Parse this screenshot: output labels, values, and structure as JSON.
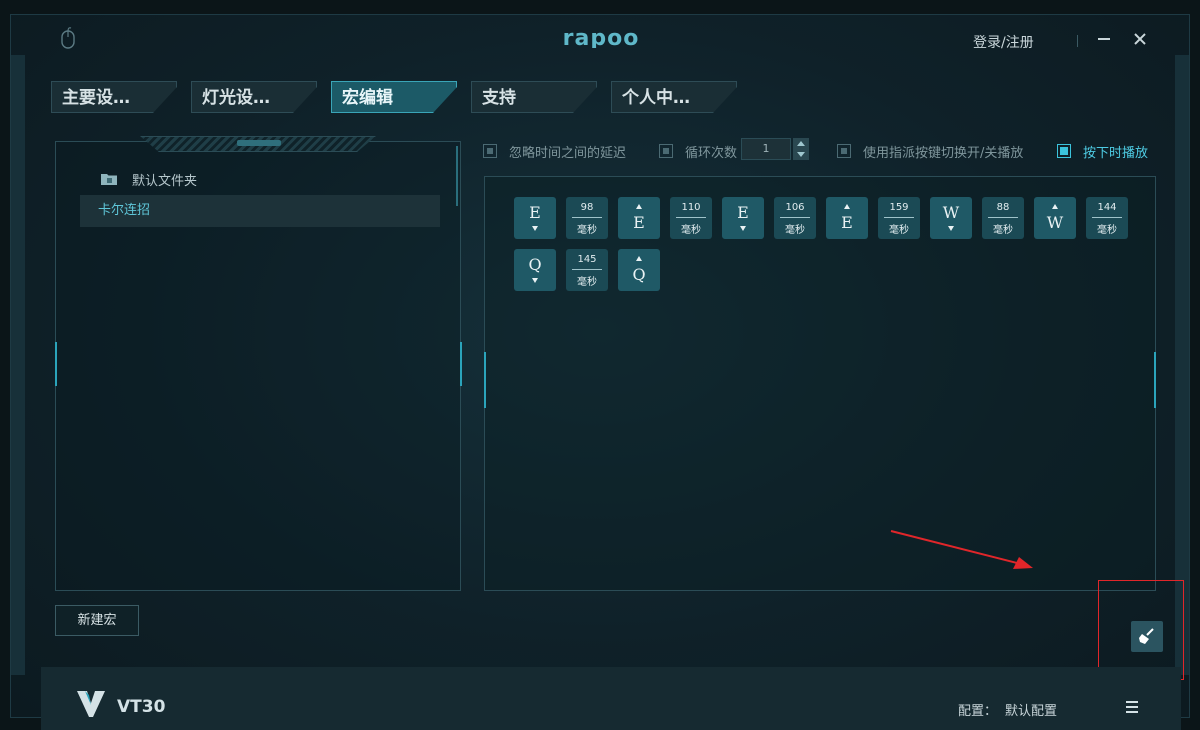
{
  "window": {
    "brand": "rapoo",
    "login_register": "登录/注册",
    "icons": [
      "mouse-icon",
      "minimize-icon",
      "close-icon"
    ]
  },
  "tabs": [
    {
      "label": "主要设…",
      "active": false
    },
    {
      "label": "灯光设…",
      "active": false
    },
    {
      "label": "宏编辑",
      "active": true
    },
    {
      "label": "支持",
      "active": false
    },
    {
      "label": "个人中…",
      "active": false
    }
  ],
  "sidebar": {
    "folder_label": "默认文件夹",
    "macros": [
      {
        "label": "卡尔连招",
        "selected": true
      }
    ],
    "new_macro_label": "新建宏"
  },
  "options": {
    "ignore_delay_label": "忽略时间之间的延迟",
    "ignore_delay_checked": false,
    "loop_count_label": "循环次数",
    "loop_count_value": "1",
    "toggle_label": "使用指派按键切换开/关播放",
    "toggle_checked": false,
    "hold_label": "按下时播放",
    "hold_checked": true
  },
  "macro_events": [
    {
      "type": "key",
      "key": "E",
      "action": "down"
    },
    {
      "type": "delay",
      "value": "98",
      "unit": "毫秒"
    },
    {
      "type": "key",
      "key": "E",
      "action": "up"
    },
    {
      "type": "delay",
      "value": "110",
      "unit": "毫秒"
    },
    {
      "type": "key",
      "key": "E",
      "action": "down"
    },
    {
      "type": "delay",
      "value": "106",
      "unit": "毫秒"
    },
    {
      "type": "key",
      "key": "E",
      "action": "up"
    },
    {
      "type": "delay",
      "value": "159",
      "unit": "毫秒"
    },
    {
      "type": "key",
      "key": "W",
      "action": "down"
    },
    {
      "type": "delay",
      "value": "88",
      "unit": "毫秒"
    },
    {
      "type": "key",
      "key": "W",
      "action": "up"
    },
    {
      "type": "delay",
      "value": "144",
      "unit": "毫秒"
    },
    {
      "type": "key",
      "key": "Q",
      "action": "down"
    },
    {
      "type": "delay",
      "value": "145",
      "unit": "毫秒"
    },
    {
      "type": "key",
      "key": "Q",
      "action": "up"
    }
  ],
  "footer": {
    "device_name": "VT30",
    "config_label": "配置：",
    "config_value": "默认配置"
  },
  "colors": {
    "accent": "#3bc3dc",
    "annotation": "#e0262a",
    "key_bg": "#1f5966"
  }
}
